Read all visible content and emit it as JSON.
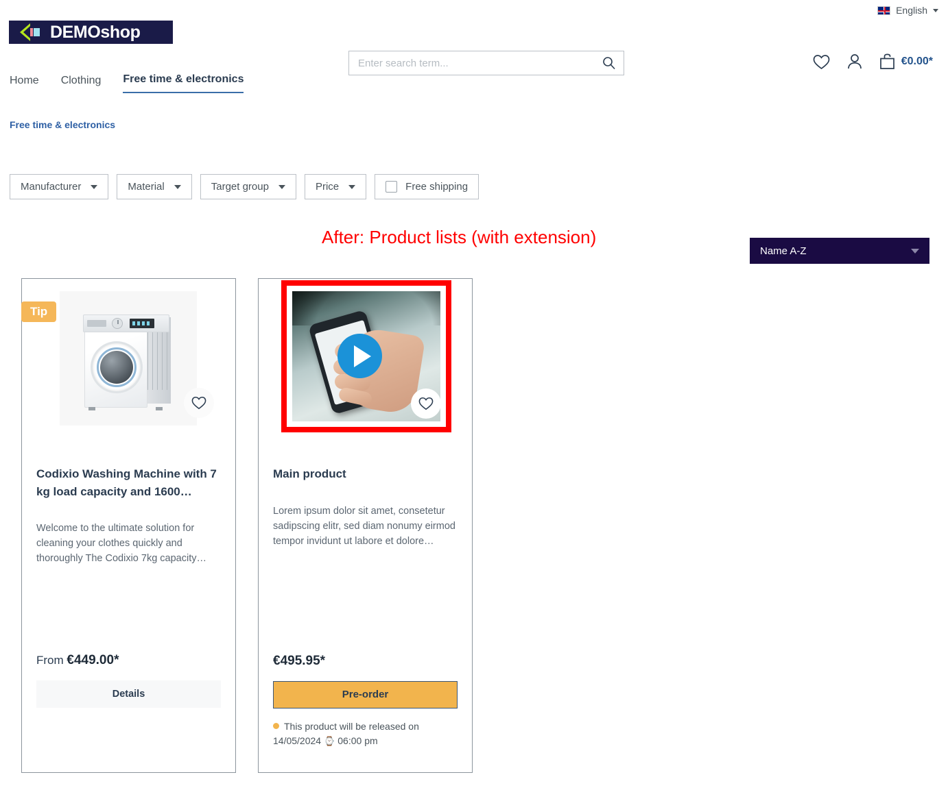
{
  "topbar": {
    "flag_icon": "uk-flag-icon",
    "language": "English",
    "caret_icon": "caret-down-icon"
  },
  "header": {
    "logo_text": "DEMOshop",
    "logo_mark_icon": "chevron-logo-icon",
    "search": {
      "placeholder": "Enter search term...",
      "value": "",
      "search_icon": "search-icon"
    },
    "actions": {
      "wishlist_icon": "heart-icon",
      "account_icon": "user-icon",
      "cart_icon": "shopping-bag-icon",
      "cart_total": "€0.00*"
    }
  },
  "nav": {
    "items": [
      {
        "label": "Home",
        "active": false
      },
      {
        "label": "Clothing",
        "active": false
      },
      {
        "label": "Free time & electronics",
        "active": true
      }
    ]
  },
  "breadcrumb": {
    "label": "Free time & electronics"
  },
  "filters": {
    "dropdowns": [
      {
        "label": "Manufacturer",
        "chevron_icon": "chevron-down-icon"
      },
      {
        "label": "Material",
        "chevron_icon": "chevron-down-icon"
      },
      {
        "label": "Target group",
        "chevron_icon": "chevron-down-icon"
      },
      {
        "label": "Price",
        "chevron_icon": "chevron-down-icon"
      }
    ],
    "checkbox": {
      "label": "Free shipping",
      "checked": false
    }
  },
  "annotation": {
    "text": "After:  Product lists  (with extension)",
    "color": "#ff0000"
  },
  "sorting": {
    "selected": "Name A-Z",
    "chevron_icon": "chevron-down-icon",
    "background": "#1a0b43"
  },
  "products": [
    {
      "badge": "Tip",
      "badge_color": "#f5b759",
      "image_icon": "washing-machine-image",
      "wishlist_icon": "heart-icon",
      "title": "Codixio Washing Machine with 7 kg load capacity and 1600…",
      "description": "Welcome to the ultimate solution for cleaning your clothes quickly and thoroughly The Codixio 7kg capacity…",
      "price_prefix": "From ",
      "price": "€449.00*",
      "button_label": "Details"
    },
    {
      "badge": null,
      "image_icon": "video-thumbnail-hand-phone",
      "play_icon": "play-button-icon",
      "wishlist_icon": "heart-icon",
      "title": "Main product",
      "description": "Lorem ipsum dolor sit amet, consetetur sadipscing elitr, sed diam nonumy eirmod tempor invidunt ut labore et dolore…",
      "price_prefix": "",
      "price": "€495.95*",
      "button_label": "Pre-order",
      "release_text": "This product will be released on",
      "release_date": "14/05/2024",
      "release_clock_icon": "watch-icon",
      "release_time": "06:00 pm"
    }
  ]
}
